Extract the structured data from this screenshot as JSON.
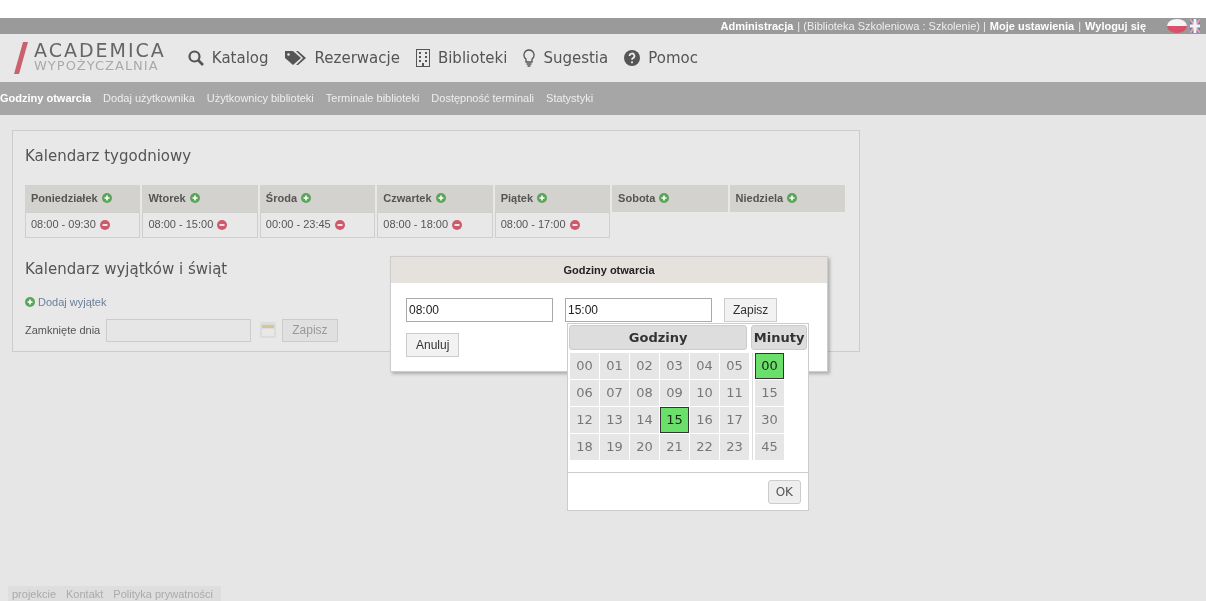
{
  "top_bar": [
    {
      "kind": "link",
      "text": "Administracja"
    },
    {
      "kind": "text",
      "text": "| (Biblioteka Szkoleniowa : Szkolenie) |"
    },
    {
      "kind": "link",
      "text": "Moje ustawienia"
    },
    {
      "kind": "text",
      "text": "|"
    },
    {
      "kind": "link",
      "text": "Wyloguj się"
    }
  ],
  "logo": {
    "line1": "ACADEMICA",
    "line2": "WYPOŻYCZALNIA"
  },
  "menu": [
    {
      "kind": "search",
      "label": "Katalog"
    },
    {
      "kind": "tag",
      "label": "Rezerwacje"
    },
    {
      "kind": "building",
      "label": "Biblioteki"
    },
    {
      "kind": "bulb",
      "label": "Sugestia"
    },
    {
      "kind": "help",
      "label": "Pomoc"
    }
  ],
  "subnav": [
    {
      "label": "Godziny otwarcia",
      "selected": true
    },
    {
      "label": "Dodaj użytkownika",
      "selected": false
    },
    {
      "label": "Użytkownicy biblioteki",
      "selected": false
    },
    {
      "label": "Terminale biblioteki",
      "selected": false
    },
    {
      "label": "Dostępność terminali",
      "selected": false
    },
    {
      "label": "Statystyki",
      "selected": false
    }
  ],
  "weekly": {
    "title": "Kalendarz tygodniowy",
    "days": [
      {
        "name": "Poniedziałek",
        "ranges": [
          "08:00 - 09:30"
        ]
      },
      {
        "name": "Wtorek",
        "ranges": [
          "08:00 - 15:00"
        ]
      },
      {
        "name": "Środa",
        "ranges": [
          "00:00 - 23:45"
        ]
      },
      {
        "name": "Czwartek",
        "ranges": [
          "08:00 - 18:00"
        ]
      },
      {
        "name": "Piątek",
        "ranges": [
          "08:00 - 17:00"
        ]
      },
      {
        "name": "Sobota"
      },
      {
        "name": "Niedziela"
      }
    ]
  },
  "exceptions": {
    "title": "Kalendarz wyjątków i świąt",
    "add_link": "Dodaj wyjątek",
    "closed_label": "Zamknięte dnia",
    "save": "Zapisz"
  },
  "dialog": {
    "title": "Godziny otwarcia",
    "from": "08:00",
    "to": "15:00",
    "save": "Zapisz",
    "cancel": "Anuluj",
    "picker": {
      "hours_title": "Godziny",
      "minutes_title": "Minuty",
      "ok": "OK",
      "hours": [
        {
          "label": "00",
          "selected": false
        },
        {
          "label": "01",
          "selected": false
        },
        {
          "label": "02",
          "selected": false
        },
        {
          "label": "03",
          "selected": false
        },
        {
          "label": "04",
          "selected": false
        },
        {
          "label": "05",
          "selected": false
        },
        {
          "label": "06",
          "selected": false
        },
        {
          "label": "07",
          "selected": false
        },
        {
          "label": "08",
          "selected": false
        },
        {
          "label": "09",
          "selected": false
        },
        {
          "label": "10",
          "selected": false
        },
        {
          "label": "11",
          "selected": false
        },
        {
          "label": "12",
          "selected": false
        },
        {
          "label": "13",
          "selected": false
        },
        {
          "label": "14",
          "selected": false
        },
        {
          "label": "15",
          "selected": true
        },
        {
          "label": "16",
          "selected": false
        },
        {
          "label": "17",
          "selected": false
        },
        {
          "label": "18",
          "selected": false
        },
        {
          "label": "19",
          "selected": false
        },
        {
          "label": "20",
          "selected": false
        },
        {
          "label": "21",
          "selected": false
        },
        {
          "label": "22",
          "selected": false
        },
        {
          "label": "23",
          "selected": false
        }
      ],
      "minutes": [
        {
          "label": "00",
          "selected": true
        },
        {
          "label": "15",
          "selected": false
        },
        {
          "label": "30",
          "selected": false
        },
        {
          "label": "45",
          "selected": false
        }
      ]
    }
  },
  "footer": [
    "projekcie",
    "Kontakt",
    "Polityka prywatności"
  ]
}
